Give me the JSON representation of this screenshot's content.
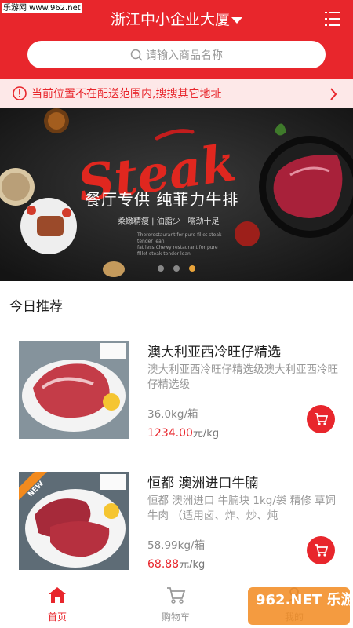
{
  "watermark": "乐游网 www.962.net",
  "header": {
    "title": "浙江中小企业大厦",
    "search_placeholder": "请输入商品名称"
  },
  "notice": {
    "text": "当前位置不在配送范围内,搜搜其它地址"
  },
  "banner": {
    "brand_text": "Steak",
    "headline": "餐厅专供 纯菲力牛排",
    "subline": "柔嫩精瘦 | 油脂少 | 嚼劲十足",
    "fine_print_1": "Thererestaurant for pure fillet steak tender lean",
    "fine_print_2": "fat less Chewy restaurant for pure fillet steak tender lean",
    "slide_count": 3,
    "active_slide": 3
  },
  "section": {
    "title": "今日推荐"
  },
  "products": [
    {
      "name": "澳大利亚西冷旺仔精选",
      "desc": "澳大利亚西冷旺仔精选级澳大利亚西冷旺仔精选级",
      "spec": "36.0kg/箱",
      "price": "1234.00",
      "unit": "元/kg",
      "badge": ""
    },
    {
      "name": "恒都 澳洲进口牛腩",
      "desc": "恒都 澳洲进口 牛腩块 1kg/袋 精修 草饲牛肉 （适用卤、炸、炒、炖",
      "spec": "58.99kg/箱",
      "price": "68.88",
      "unit": "元/kg",
      "badge": "NEW"
    }
  ],
  "tabbar": {
    "home": "首页",
    "cart": "购物车",
    "mine": "我的"
  },
  "overlay_badge": "962.NET 乐游网",
  "colors": {
    "brand_red": "#e8262c",
    "notice_bg": "#fde8e8",
    "price_red": "#e8262c"
  }
}
